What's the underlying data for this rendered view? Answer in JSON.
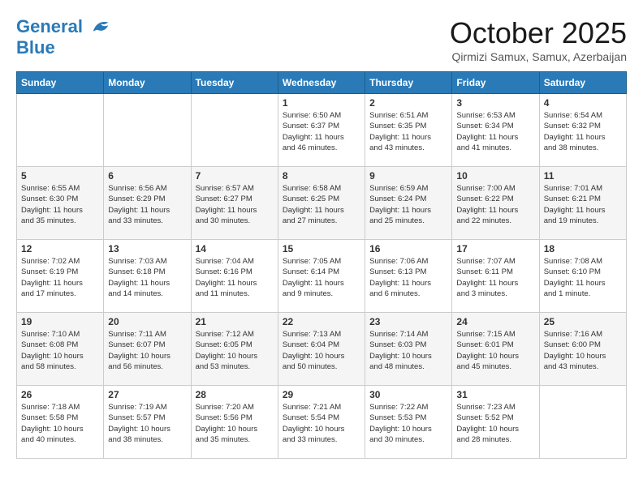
{
  "header": {
    "logo_line1": "General",
    "logo_line2": "Blue",
    "month": "October 2025",
    "location": "Qirmizi Samux, Samux, Azerbaijan"
  },
  "days_of_week": [
    "Sunday",
    "Monday",
    "Tuesday",
    "Wednesday",
    "Thursday",
    "Friday",
    "Saturday"
  ],
  "weeks": [
    [
      {
        "day": "",
        "info": ""
      },
      {
        "day": "",
        "info": ""
      },
      {
        "day": "",
        "info": ""
      },
      {
        "day": "1",
        "info": "Sunrise: 6:50 AM\nSunset: 6:37 PM\nDaylight: 11 hours\nand 46 minutes."
      },
      {
        "day": "2",
        "info": "Sunrise: 6:51 AM\nSunset: 6:35 PM\nDaylight: 11 hours\nand 43 minutes."
      },
      {
        "day": "3",
        "info": "Sunrise: 6:53 AM\nSunset: 6:34 PM\nDaylight: 11 hours\nand 41 minutes."
      },
      {
        "day": "4",
        "info": "Sunrise: 6:54 AM\nSunset: 6:32 PM\nDaylight: 11 hours\nand 38 minutes."
      }
    ],
    [
      {
        "day": "5",
        "info": "Sunrise: 6:55 AM\nSunset: 6:30 PM\nDaylight: 11 hours\nand 35 minutes."
      },
      {
        "day": "6",
        "info": "Sunrise: 6:56 AM\nSunset: 6:29 PM\nDaylight: 11 hours\nand 33 minutes."
      },
      {
        "day": "7",
        "info": "Sunrise: 6:57 AM\nSunset: 6:27 PM\nDaylight: 11 hours\nand 30 minutes."
      },
      {
        "day": "8",
        "info": "Sunrise: 6:58 AM\nSunset: 6:25 PM\nDaylight: 11 hours\nand 27 minutes."
      },
      {
        "day": "9",
        "info": "Sunrise: 6:59 AM\nSunset: 6:24 PM\nDaylight: 11 hours\nand 25 minutes."
      },
      {
        "day": "10",
        "info": "Sunrise: 7:00 AM\nSunset: 6:22 PM\nDaylight: 11 hours\nand 22 minutes."
      },
      {
        "day": "11",
        "info": "Sunrise: 7:01 AM\nSunset: 6:21 PM\nDaylight: 11 hours\nand 19 minutes."
      }
    ],
    [
      {
        "day": "12",
        "info": "Sunrise: 7:02 AM\nSunset: 6:19 PM\nDaylight: 11 hours\nand 17 minutes."
      },
      {
        "day": "13",
        "info": "Sunrise: 7:03 AM\nSunset: 6:18 PM\nDaylight: 11 hours\nand 14 minutes."
      },
      {
        "day": "14",
        "info": "Sunrise: 7:04 AM\nSunset: 6:16 PM\nDaylight: 11 hours\nand 11 minutes."
      },
      {
        "day": "15",
        "info": "Sunrise: 7:05 AM\nSunset: 6:14 PM\nDaylight: 11 hours\nand 9 minutes."
      },
      {
        "day": "16",
        "info": "Sunrise: 7:06 AM\nSunset: 6:13 PM\nDaylight: 11 hours\nand 6 minutes."
      },
      {
        "day": "17",
        "info": "Sunrise: 7:07 AM\nSunset: 6:11 PM\nDaylight: 11 hours\nand 3 minutes."
      },
      {
        "day": "18",
        "info": "Sunrise: 7:08 AM\nSunset: 6:10 PM\nDaylight: 11 hours\nand 1 minute."
      }
    ],
    [
      {
        "day": "19",
        "info": "Sunrise: 7:10 AM\nSunset: 6:08 PM\nDaylight: 10 hours\nand 58 minutes."
      },
      {
        "day": "20",
        "info": "Sunrise: 7:11 AM\nSunset: 6:07 PM\nDaylight: 10 hours\nand 56 minutes."
      },
      {
        "day": "21",
        "info": "Sunrise: 7:12 AM\nSunset: 6:05 PM\nDaylight: 10 hours\nand 53 minutes."
      },
      {
        "day": "22",
        "info": "Sunrise: 7:13 AM\nSunset: 6:04 PM\nDaylight: 10 hours\nand 50 minutes."
      },
      {
        "day": "23",
        "info": "Sunrise: 7:14 AM\nSunset: 6:03 PM\nDaylight: 10 hours\nand 48 minutes."
      },
      {
        "day": "24",
        "info": "Sunrise: 7:15 AM\nSunset: 6:01 PM\nDaylight: 10 hours\nand 45 minutes."
      },
      {
        "day": "25",
        "info": "Sunrise: 7:16 AM\nSunset: 6:00 PM\nDaylight: 10 hours\nand 43 minutes."
      }
    ],
    [
      {
        "day": "26",
        "info": "Sunrise: 7:18 AM\nSunset: 5:58 PM\nDaylight: 10 hours\nand 40 minutes."
      },
      {
        "day": "27",
        "info": "Sunrise: 7:19 AM\nSunset: 5:57 PM\nDaylight: 10 hours\nand 38 minutes."
      },
      {
        "day": "28",
        "info": "Sunrise: 7:20 AM\nSunset: 5:56 PM\nDaylight: 10 hours\nand 35 minutes."
      },
      {
        "day": "29",
        "info": "Sunrise: 7:21 AM\nSunset: 5:54 PM\nDaylight: 10 hours\nand 33 minutes."
      },
      {
        "day": "30",
        "info": "Sunrise: 7:22 AM\nSunset: 5:53 PM\nDaylight: 10 hours\nand 30 minutes."
      },
      {
        "day": "31",
        "info": "Sunrise: 7:23 AM\nSunset: 5:52 PM\nDaylight: 10 hours\nand 28 minutes."
      },
      {
        "day": "",
        "info": ""
      }
    ]
  ]
}
